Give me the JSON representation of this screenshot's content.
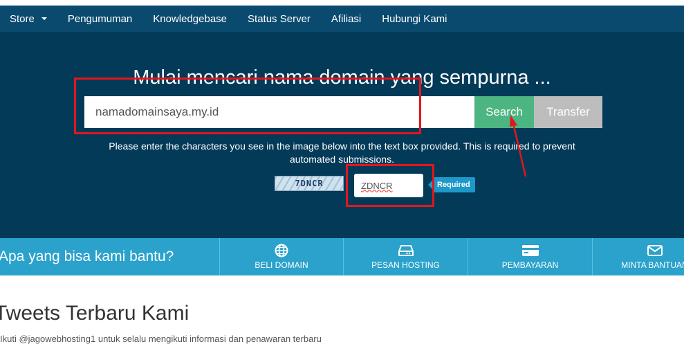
{
  "nav": {
    "items": [
      "Store",
      "Pengumuman",
      "Knowledgebase",
      "Status Server",
      "Afiliasi",
      "Hubungi Kami"
    ]
  },
  "hero": {
    "title": "Mulai mencari nama domain yang sempurna ...",
    "domain_value": "namadomainsaya.my.id",
    "search_label": "Search",
    "transfer_label": "Transfer",
    "captcha_instructions": "Please enter the characters you see in the image below into the text box provided. This is required to prevent automated submissions.",
    "captcha_code": "7DNCR",
    "captcha_value": "ZDNCR",
    "required_label": "Required"
  },
  "help": {
    "text": "Apa yang bisa kami bantu?",
    "links": [
      {
        "label": "BELI DOMAIN",
        "icon": "globe-icon"
      },
      {
        "label": "PESAN HOSTING",
        "icon": "server-icon"
      },
      {
        "label": "PEMBAYARAN",
        "icon": "credit-card-icon"
      },
      {
        "label": "MINTA BANTUAN",
        "icon": "envelope-icon"
      }
    ]
  },
  "news": {
    "title": "Tweets Terbaru Kami",
    "subtitle": "Ikuti @jagowebhosting1 untuk selalu mengikuti informasi dan penawaran terbaru"
  },
  "colors": {
    "navbar": "#0b4a6f",
    "hero": "#033a58",
    "search": "#4cb582",
    "transfer": "#bdbdbd",
    "help_bar": "#2aa2cc",
    "highlight": "#e3161c"
  }
}
